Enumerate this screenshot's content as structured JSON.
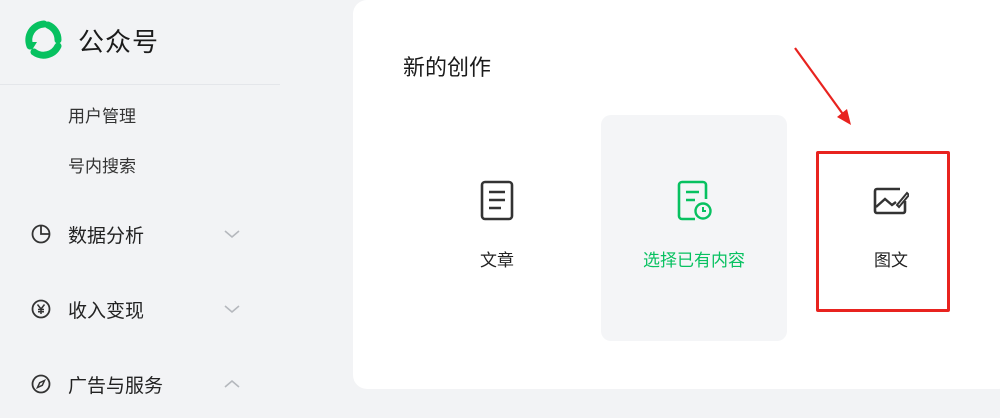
{
  "sidebar": {
    "logo_title": "公众号",
    "sub_items": [
      {
        "label": "用户管理"
      },
      {
        "label": "号内搜索"
      }
    ],
    "menu": [
      {
        "label": "数据分析",
        "icon": "pie-chart-icon",
        "chevron": "down"
      },
      {
        "label": "收入变现",
        "icon": "yen-circle-icon",
        "chevron": "down"
      },
      {
        "label": "广告与服务",
        "icon": "compass-icon",
        "chevron": "up"
      }
    ]
  },
  "main": {
    "section_title": "新的创作",
    "cards": [
      {
        "label": "文章",
        "icon": "article-icon"
      },
      {
        "label": "选择已有内容",
        "icon": "existing-content-icon",
        "selected": true
      },
      {
        "label": "图文",
        "icon": "image-text-icon",
        "highlighted": true
      }
    ]
  },
  "colors": {
    "brand_green": "#07c160",
    "annotation_red": "#e8231f"
  }
}
